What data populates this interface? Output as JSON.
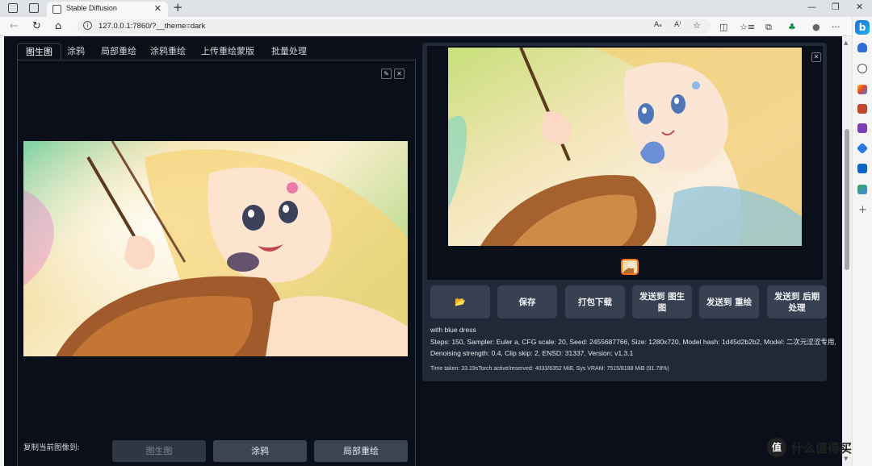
{
  "browser": {
    "tab_title": "Stable Diffusion",
    "tab_close": "✕",
    "new_tab": "+",
    "url": "127.0.0.1:7860/?__theme=dark",
    "url_info": "i",
    "minimize": "—",
    "restore": "❐",
    "close": "✕",
    "back": "←",
    "reload": "↻",
    "home": "⌂",
    "read_aloud": "Aₐ",
    "translate": "A⁾",
    "favorite": "☆",
    "split": "◫",
    "favorites_bar": "☆≡",
    "collections": "⧉",
    "extensions": "♣",
    "profile": "●",
    "more": "···",
    "bing_label": "b",
    "sidebar_add": "+"
  },
  "tabs": [
    {
      "label": "图生图",
      "active": true
    },
    {
      "label": "涂鸦",
      "active": false
    },
    {
      "label": "局部重绘",
      "active": false
    },
    {
      "label": "涂鸦重绘",
      "active": false
    },
    {
      "label": "上传重绘蒙版",
      "active": false
    },
    {
      "label": "批量处理",
      "active": false
    }
  ],
  "input_image": {
    "edit_icon": "✎",
    "close_icon": "✕"
  },
  "copy_to": {
    "label": "复制当前图像到:",
    "buttons": [
      "图生图",
      "涂鸦",
      "局部重绘"
    ]
  },
  "gallery": {
    "close_icon": "✕"
  },
  "actions": {
    "folder": "📂",
    "save": "保存",
    "zip": "打包下载",
    "send_img2img": "发送到 图生图",
    "send_inpaint": "发送到 重绘",
    "send_extras": "发送到 后期处理"
  },
  "generation_info": {
    "prompt": "with blue dress",
    "params_line1": "Steps: 150, Sampler: Euler a, CFG scale: 20, Seed: 2455687766, Size: 1280x720, Model hash: 1d45d2b2b2, Model: 二次元涩涩专用,",
    "params_line2": "Denoising strength: 0.4, Clip skip: 2, ENSD: 31337, Version: v1.3.1",
    "timing": "Time taken: 33.19sTorch active/reserved: 4033/6352 MiB, Sys VRAM: 7515/8188 MiB (91.78%)"
  },
  "watermark": {
    "icon": "值",
    "text": "什么值得买"
  },
  "colors": {
    "page_bg": "#0b0f19",
    "panel_bg": "#1f2937",
    "button_bg": "#374151",
    "accent": "#f97316"
  }
}
